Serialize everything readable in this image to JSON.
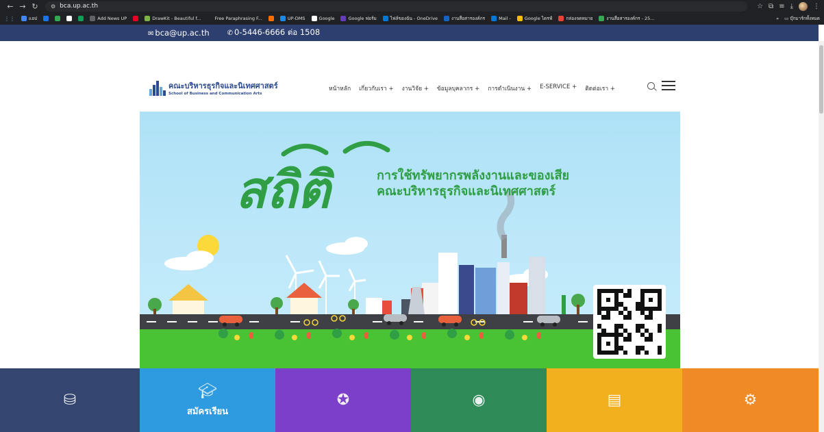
{
  "browser": {
    "url": "bca.up.ac.th",
    "bookmarks": [
      {
        "label": "แอป",
        "color": "#4285f4"
      },
      {
        "label": "",
        "color": "#1a73e8"
      },
      {
        "label": "",
        "color": "#34a853"
      },
      {
        "label": "",
        "color": "#ffffff"
      },
      {
        "label": "",
        "color": "#0f9d58"
      },
      {
        "label": "Add News UP",
        "color": "#5f6368"
      },
      {
        "label": "",
        "color": "#e60023"
      },
      {
        "label": "DrawKit - Beautiful f...",
        "color": "#7cb342"
      },
      {
        "label": "Free Paraphrasing F...",
        "color": "#202124"
      },
      {
        "label": "",
        "color": "#ff6f00"
      },
      {
        "label": "UP-DMS",
        "color": "#1e88e5"
      },
      {
        "label": "Google",
        "color": "#ffffff"
      },
      {
        "label": "Google ฟอร์ม",
        "color": "#673ab7"
      },
      {
        "label": "ไฟล์ของฉัน - OneDrive",
        "color": "#0078d4"
      },
      {
        "label": "งานสื่อสารองค์กร",
        "color": "#1565c0"
      },
      {
        "label": "Mail -",
        "color": "#0078d4"
      },
      {
        "label": "Google ไดรฟ์",
        "color": "#fbbc04"
      },
      {
        "label": "กล่องจดหมาย",
        "color": "#ea4335"
      },
      {
        "label": "งานสื่อสารองค์กร - 25...",
        "color": "#34a853"
      }
    ],
    "more": "»",
    "all_bookmarks": "บุ๊กมาร์กทั้งหมด"
  },
  "topbar": {
    "email": "bca@up.ac.th",
    "phone": "0-5446-6666 ต่อ 1508"
  },
  "header": {
    "logo_th": "คณะบริหารธุรกิจและนิเทศศาสตร์",
    "logo_en": "School of Business and Communication Arts",
    "nav": [
      "หน้าหลัก",
      "เกี่ยวกับเรา +",
      "งานวิจัย +",
      "ข้อมูลบุคลากร +",
      "การดำเนินงาน +",
      "E-SERVICE +",
      "ติดต่อเรา +"
    ]
  },
  "hero": {
    "headline_art": "สถิติ",
    "line1": "การใช้ทรัพยากรพลังงานและของเสีย",
    "line2": "คณะบริหารธุรกิจและนิเทศศาสตร์"
  },
  "tiles": [
    {
      "icon": "people-board-icon",
      "label": "",
      "color": "#34456f"
    },
    {
      "icon": "graduation-cap-icon",
      "label": "สมัครเรียน",
      "color": "#2e9be0"
    },
    {
      "icon": "award-icon",
      "label": "",
      "color": "#7c3fc9"
    },
    {
      "icon": "360-view-icon",
      "label": "",
      "color": "#2e8b57"
    },
    {
      "icon": "certificate-icon",
      "label": "",
      "color": "#f2b01e"
    },
    {
      "icon": "research-icon",
      "label": "",
      "color": "#f08a24"
    }
  ]
}
